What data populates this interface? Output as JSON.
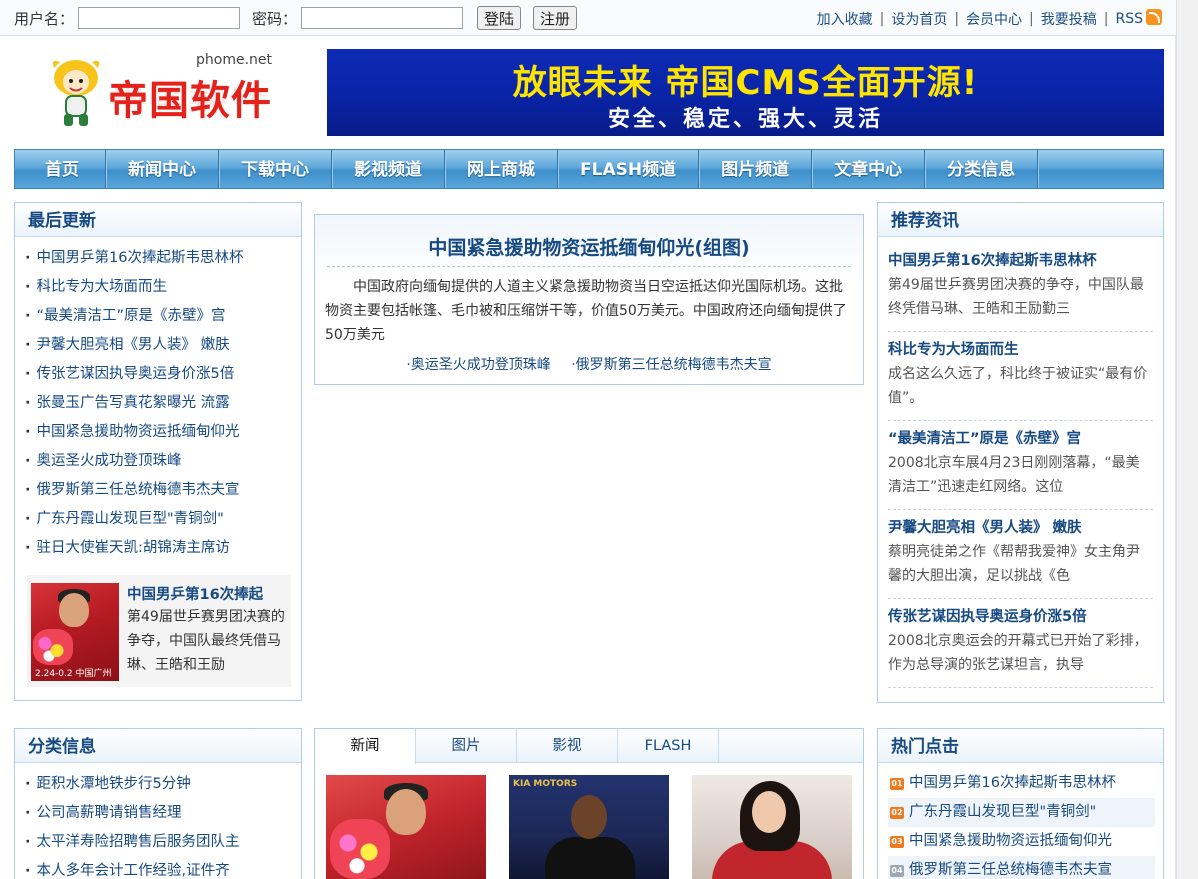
{
  "topbar": {
    "username_label": "用户名：",
    "password_label": "密码：",
    "login_button": "登陆",
    "register_button": "注册",
    "links": [
      "加入收藏",
      "设为首页",
      "会员中心",
      "我要投稿",
      "RSS"
    ]
  },
  "header": {
    "logo_domain": "phome.net",
    "logo_text": "帝国软件",
    "banner_line1": "放眼未来 帝国CMS全面开源!",
    "banner_line2": "安全、稳定、强大、灵活"
  },
  "nav": [
    "首页",
    "新闻中心",
    "下载中心",
    "影视频道",
    "网上商城",
    "FLASH频道",
    "图片频道",
    "文章中心",
    "分类信息"
  ],
  "latest": {
    "title": "最后更新",
    "items": [
      "中国男乒第16次捧起斯韦思林杯",
      "科比专为大场面而生",
      "“最美清洁工”原是《赤壁》宫",
      "尹馨大胆亮相《男人装》 嫩肤",
      "传张艺谋因执导奥运身价涨5倍",
      "张曼玉广告写真花絮曝光 流露",
      "中国紧急援助物资运抵缅甸仰光",
      "奥运圣火成功登顶珠峰",
      "俄罗斯第三任总统梅德韦杰夫宣",
      "广东丹霞山发现巨型\"青铜剑\"",
      "驻日大使崔天凯:胡锦涛主席访"
    ],
    "feature": {
      "title": "中国男乒第16次捧起",
      "desc": "第49届世乒赛男团决赛的争夺，中国队最终凭借马琳、王皓和王励",
      "caption": "2.24-0.2 中国广州"
    }
  },
  "headline": {
    "title": "中国紧急援助物资运抵缅甸仰光(组图)",
    "summary": "中国政府向缅甸提供的人道主义紧急援助物资当日空运抵达仰光国际机场。这批物资主要包括帐篷、毛巾被和压缩饼干等，价值50万美元。中国政府还向缅甸提供了50万美元",
    "related": [
      "·奥运圣火成功登顶珠峰",
      "·俄罗斯第三任总统梅德韦杰夫宣"
    ]
  },
  "recommend": {
    "title": "推荐资讯",
    "items": [
      {
        "title": "中国男乒第16次捧起斯韦思林杯",
        "desc": "第49届世乒赛男团决赛的争夺，中国队最终凭借马琳、王皓和王励勤三"
      },
      {
        "title": "科比专为大场面而生",
        "desc": "成名这么久远了，科比终于被证实“最有价值”。"
      },
      {
        "title": "“最美清洁工”原是《赤壁》宫",
        "desc": "2008北京车展4月23日刚刚落幕，“最美清洁工”迅速走红网络。这位"
      },
      {
        "title": "尹馨大胆亮相《男人装》 嫩肤",
        "desc": "蔡明亮徒弟之作《帮帮我爱神》女主角尹馨的大胆出演，足以挑战《色"
      },
      {
        "title": "传张艺谋因执导奥运身价涨5倍",
        "desc": "2008北京奥运会的开幕式已开始了彩排，作为总导演的张艺谋坦言，执导"
      }
    ]
  },
  "classified": {
    "title": "分类信息",
    "items": [
      "距积水潭地铁步行5分钟",
      "公司高薪聘请销售经理",
      "太平洋寿险招聘售后服务团队主",
      "本人多年会计工作经验,证件齐"
    ]
  },
  "tabs": {
    "labels": [
      "新闻",
      "图片",
      "影视",
      "FLASH"
    ],
    "thumb2_text": "KIA MOTORS"
  },
  "hot": {
    "title": "热门点击",
    "items": [
      {
        "rank": "01",
        "text": "中国男乒第16次捧起斯韦思林杯"
      },
      {
        "rank": "02",
        "text": "广东丹霞山发现巨型\"青铜剑\""
      },
      {
        "rank": "03",
        "text": "中国紧急援助物资运抵缅甸仰光"
      },
      {
        "rank": "04",
        "text": "俄罗斯第三任总统梅德韦杰夫宣"
      }
    ]
  }
}
